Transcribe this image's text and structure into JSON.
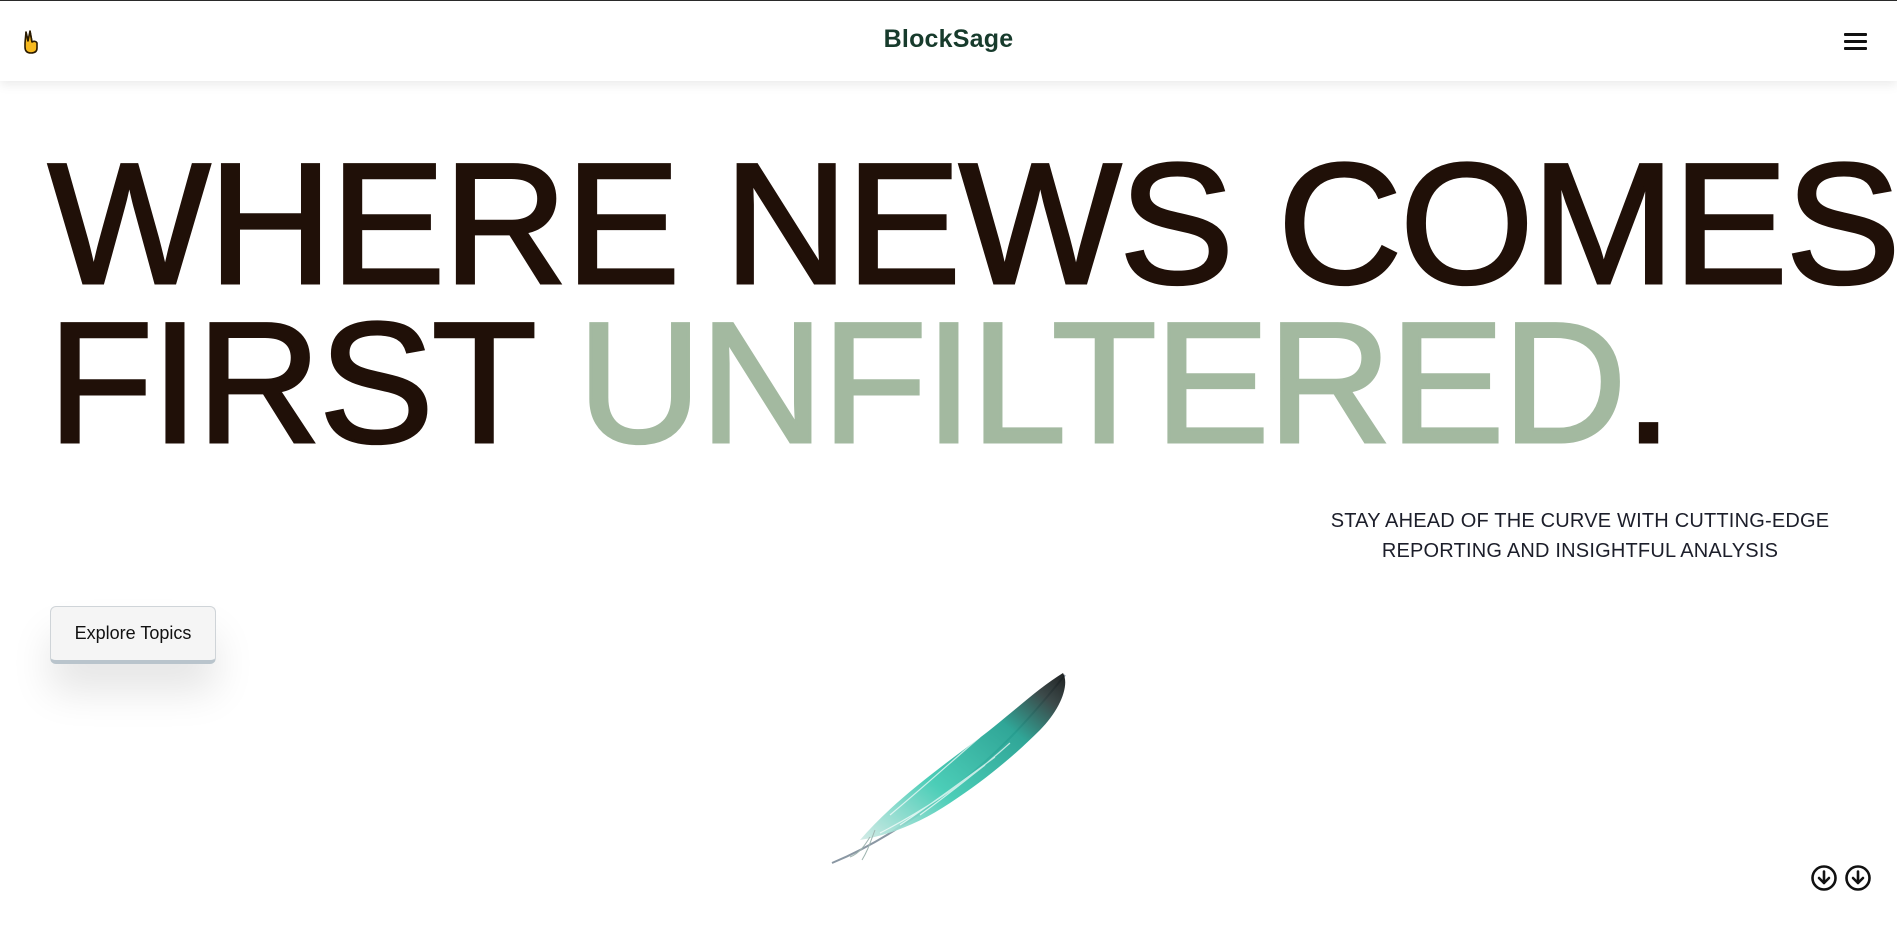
{
  "header": {
    "logo_emoji": "✌",
    "brand": "BlockSage",
    "menu_icon": "hamburger-menu-icon"
  },
  "hero": {
    "line1": "WHERE NEWS COMES",
    "line2_prefix": "FIRST",
    "line2_accent": "UNFILTERED",
    "line2_suffix": ".",
    "accent_color": "#a3b9a0",
    "text_color": "#201008"
  },
  "tagline": {
    "line1": "STAY AHEAD OF THE CURVE WITH CUTTING-EDGE",
    "line2": "REPORTING AND INSIGHTFUL ANALYSIS"
  },
  "cta": {
    "label": "Explore Topics"
  },
  "illustration": {
    "icon": "feather-illustration",
    "color": "#2ab9a3"
  },
  "scroll_controls": [
    {
      "icon": "arrow-down-circle-icon"
    },
    {
      "icon": "arrow-down-circle-icon"
    }
  ]
}
